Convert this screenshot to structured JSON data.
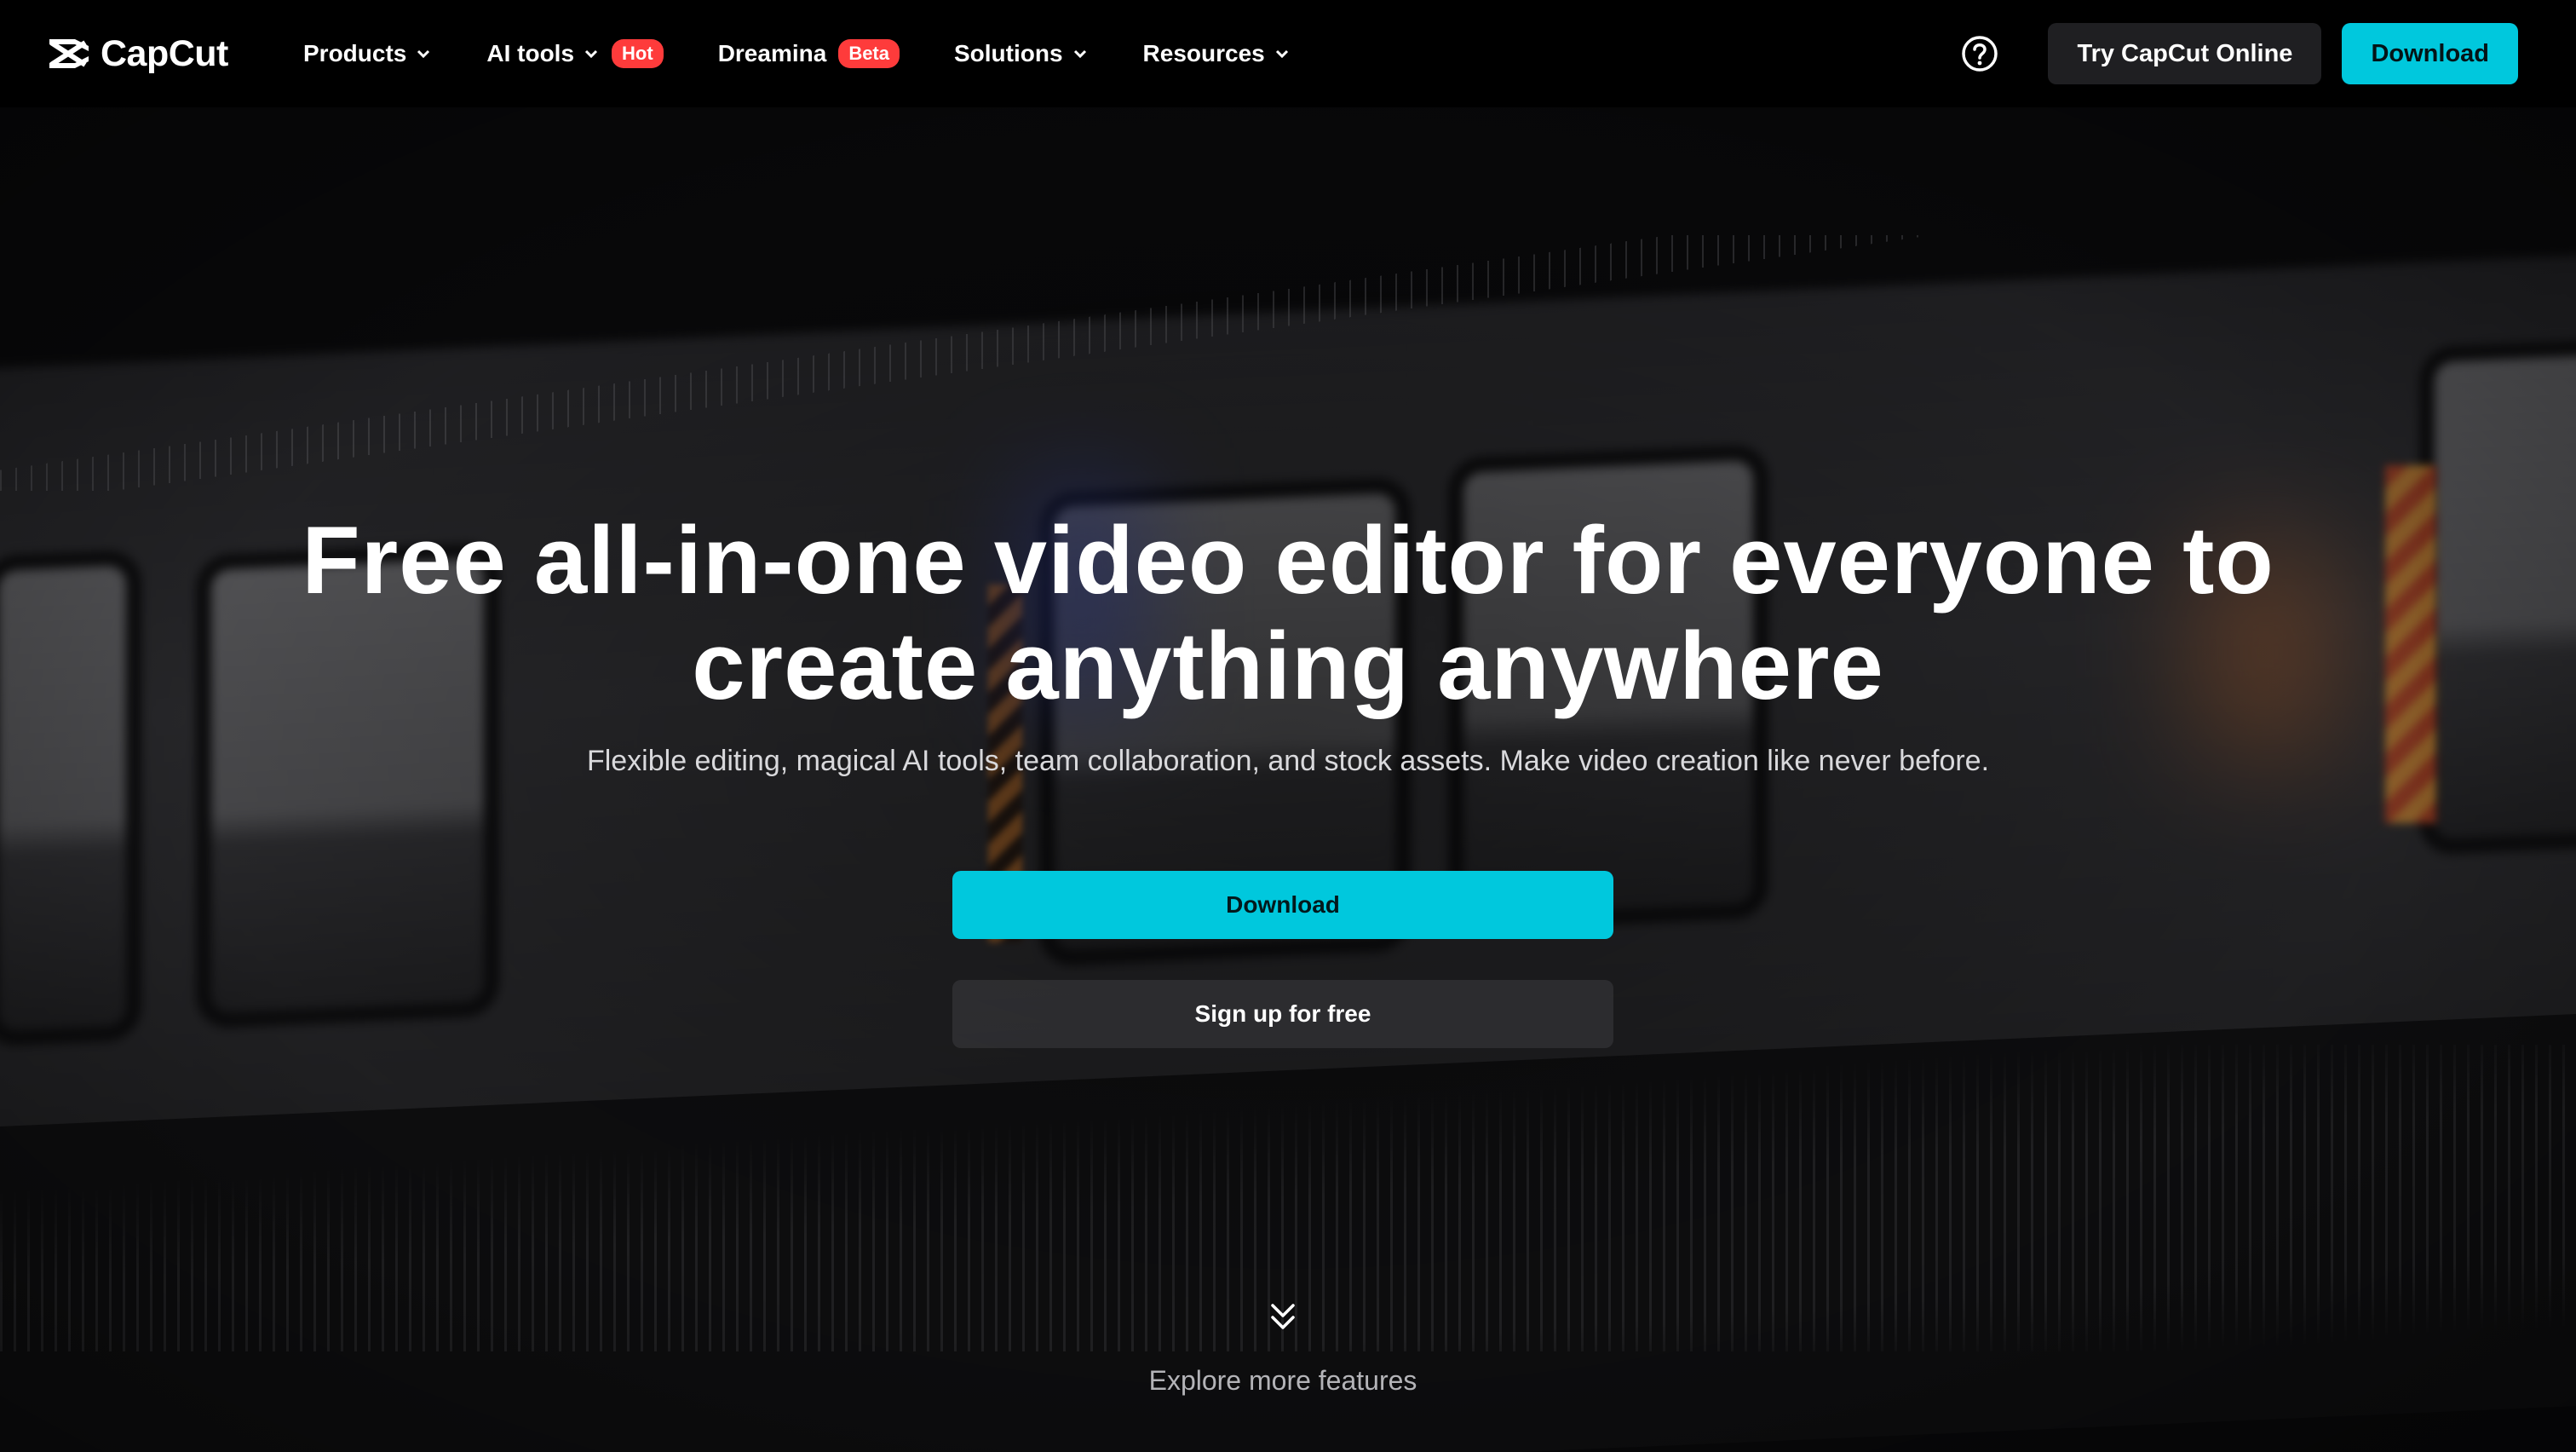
{
  "brand": {
    "name": "CapCut"
  },
  "nav": {
    "items": [
      {
        "label": "Products",
        "icon": "chevron-down-icon"
      },
      {
        "label": "AI tools",
        "icon": "chevron-down-icon",
        "badge": "Hot"
      },
      {
        "label": "Dreamina",
        "badge": "Beta"
      },
      {
        "label": "Solutions",
        "icon": "chevron-down-icon"
      },
      {
        "label": "Resources",
        "icon": "chevron-down-icon"
      }
    ],
    "help_icon": "help-circle-icon",
    "try_online_label": "Try CapCut Online",
    "download_label": "Download"
  },
  "hero": {
    "title_line1": "Free all-in-one video editor for everyone to",
    "title_line2": "create anything anywhere",
    "subtitle": "Flexible editing, magical AI tools, team collaboration, and stock assets. Make video creation like never before.",
    "download_label": "Download",
    "signup_label": "Sign up for free",
    "explore_label": "Explore more features",
    "explore_icon": "double-chevron-down-icon"
  },
  "colors": {
    "accent": "#00c8dd",
    "badge": "#fe3b3b",
    "nav_bg": "#000000"
  }
}
